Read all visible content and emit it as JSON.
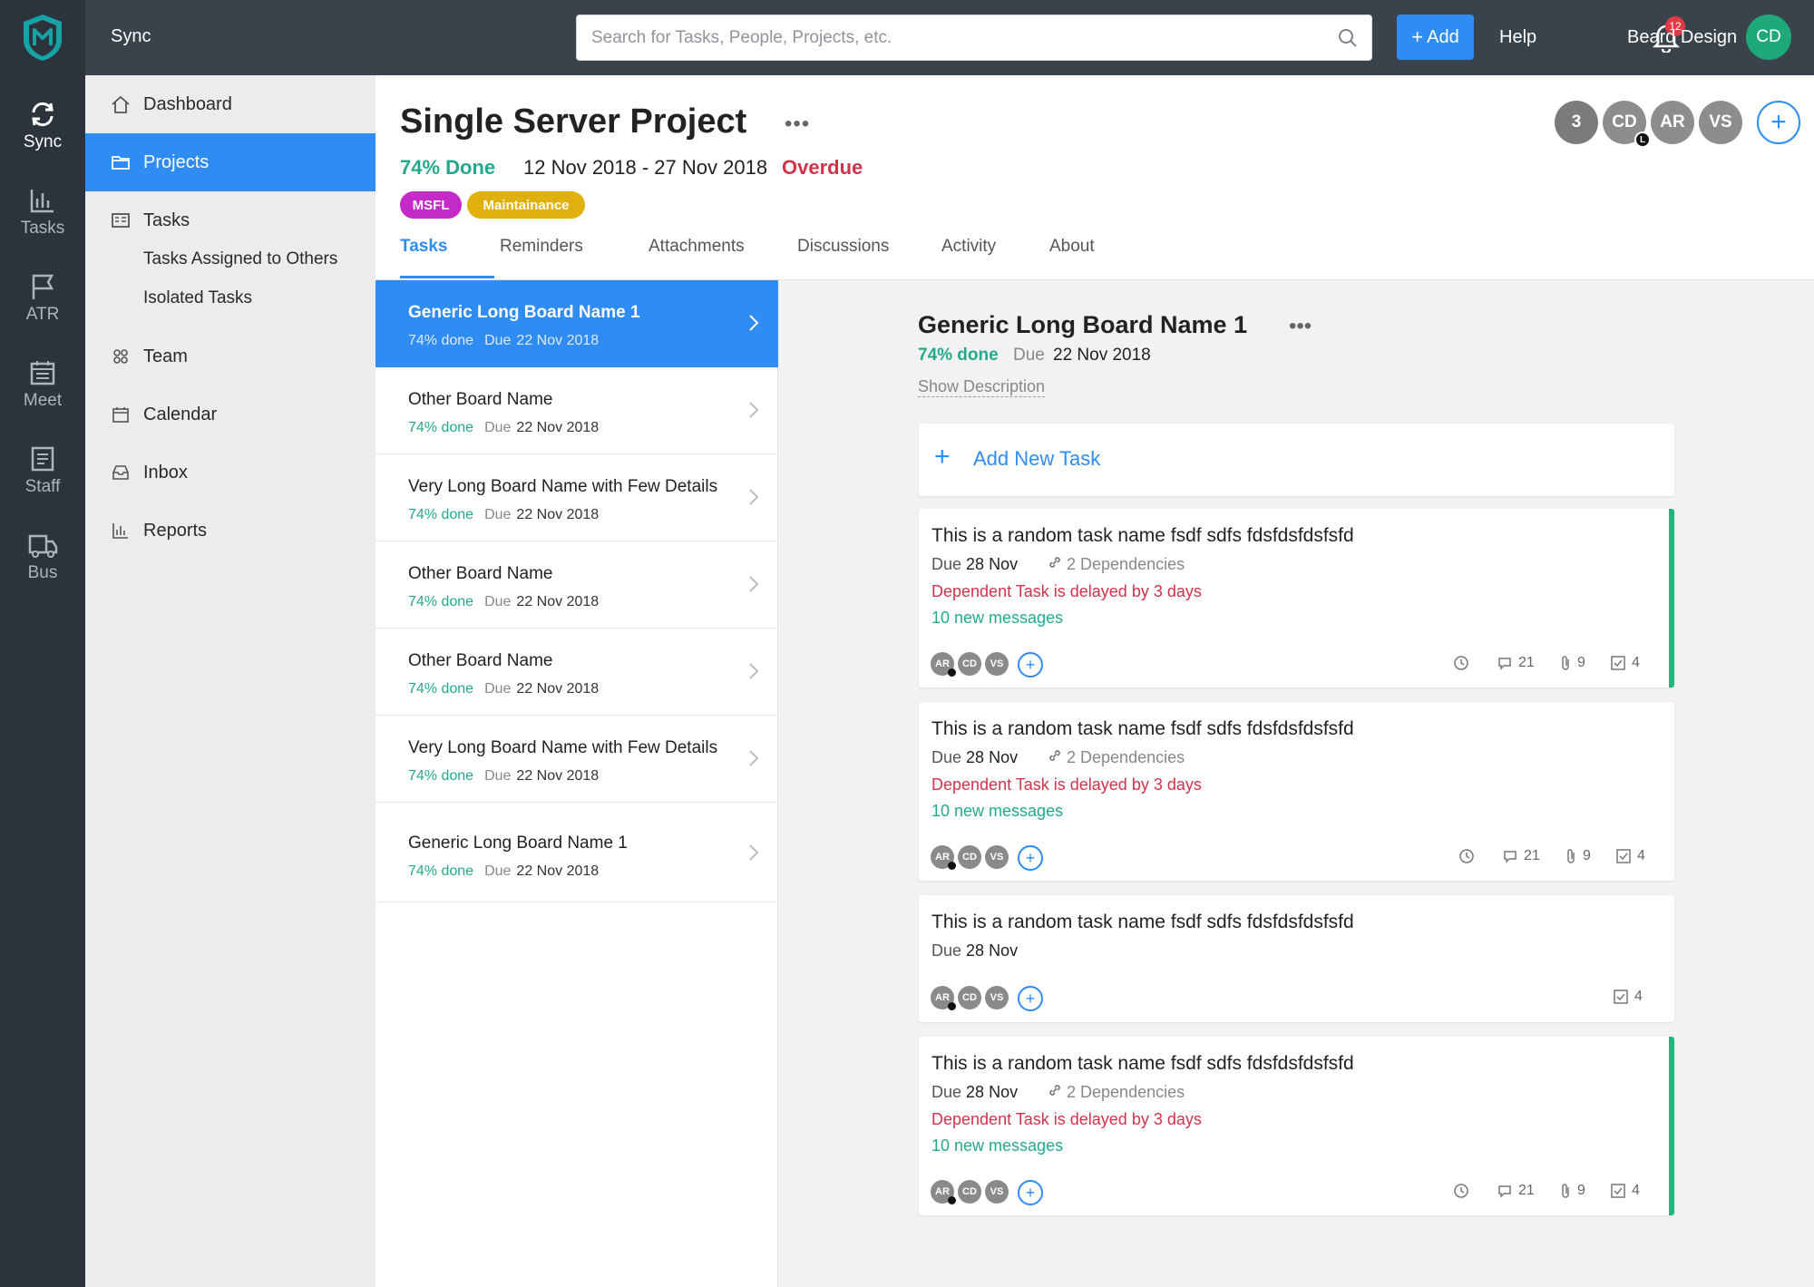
{
  "rail": {
    "items": [
      {
        "label": "Sync",
        "icon": "sync-icon"
      },
      {
        "label": "Tasks",
        "icon": "bar-chart-icon"
      },
      {
        "label": "ATR",
        "icon": "flag-icon"
      },
      {
        "label": "Meet",
        "icon": "calendar-icon"
      },
      {
        "label": "Staff",
        "icon": "document-icon"
      },
      {
        "label": "Bus",
        "icon": "truck-icon"
      }
    ]
  },
  "topbar": {
    "app_name": "Sync",
    "search_placeholder": "Search for Tasks, People, Projects, etc.",
    "add_label": "Add",
    "help_label": "Help",
    "notification_count": "12",
    "user_name": "Beard Design",
    "user_initials": "CD"
  },
  "sidebar": {
    "dashboard": "Dashboard",
    "projects": "Projects",
    "tasks": "Tasks",
    "tasks_assigned": "Tasks Assigned to Others",
    "isolated_tasks": "Isolated Tasks",
    "team": "Team",
    "calendar": "Calendar",
    "inbox": "Inbox",
    "reports": "Reports"
  },
  "project": {
    "title": "Single Server Project",
    "done": "74% Done",
    "dates": "12 Nov 2018 - 27 Nov 2018",
    "status": "Overdue",
    "tags": [
      "MSFL",
      "Maintainance"
    ],
    "tabs": [
      "Tasks",
      "Reminders",
      "Attachments",
      "Discussions",
      "Activity",
      "About"
    ],
    "members": [
      "3",
      "CD",
      "AR",
      "VS"
    ],
    "member_badge": "L",
    "colors": {
      "accent": "#2f8cf2",
      "done": "#25a98d",
      "overdue": "#d2324a"
    }
  },
  "boards": [
    {
      "name": "Generic Long Board Name 1",
      "pct": "74% done",
      "due_label": "Due",
      "due": "22 Nov 2018"
    },
    {
      "name": "Other Board Name",
      "pct": "74% done",
      "due_label": "Due",
      "due": "22 Nov 2018"
    },
    {
      "name": "Very Long Board Name with Few Details",
      "pct": "74% done",
      "due_label": "Due",
      "due": "22 Nov 2018"
    },
    {
      "name": "Other Board Name",
      "pct": "74% done",
      "due_label": "Due",
      "due": "22 Nov 2018"
    },
    {
      "name": "Other Board Name",
      "pct": "74% done",
      "due_label": "Due",
      "due": "22 Nov 2018"
    },
    {
      "name": "Very Long Board Name with Few Details",
      "pct": "74% done",
      "due_label": "Due",
      "due": "22 Nov 2018"
    },
    {
      "name": "Generic Long Board Name 1",
      "pct": "74% done",
      "due_label": "Due",
      "due": "22 Nov 2018"
    }
  ],
  "detail": {
    "title": "Generic Long Board Name 1",
    "pct": "74% done",
    "due_label": "Due",
    "due": "22 Nov 2018",
    "show_description": "Show Description",
    "add_task": "Add New Task"
  },
  "tasks": [
    {
      "name": "This is a random task name fsdf sdfs fdsfdsfdsfsfd",
      "due_label": "Due",
      "due": "28 Nov",
      "dependencies": "2 Dependencies",
      "delay": "Dependent Task is delayed by 3 days",
      "messages": "10 new messages",
      "avatars": [
        "AR",
        "CD",
        "VS"
      ],
      "comments": "21",
      "attachments": "9",
      "checks": "4"
    },
    {
      "name": "This is a random task name fsdf sdfs fdsfdsfdsfsfd",
      "due_label": "Due",
      "due": "28 Nov",
      "dependencies": "2 Dependencies",
      "delay": "Dependent Task is delayed by 3 days",
      "messages": "10 new messages",
      "avatars": [
        "AR",
        "CD",
        "VS"
      ],
      "comments": "21",
      "attachments": "9",
      "checks": "4"
    },
    {
      "name": "This is a random task name fsdf sdfs fdsfdsfdsfsfd",
      "due_label": "Due",
      "due": "28 Nov",
      "avatars": [
        "AR",
        "CD",
        "VS"
      ],
      "checks": "4"
    },
    {
      "name": "This is a random task name fsdf sdfs fdsfdsfdsfsfd",
      "due_label": "Due",
      "due": "28 Nov",
      "dependencies": "2 Dependencies",
      "delay": "Dependent Task is delayed by 3 days",
      "messages": "10 new messages",
      "avatars": [
        "AR",
        "CD",
        "VS"
      ],
      "comments": "21",
      "attachments": "9",
      "checks": "4"
    }
  ]
}
